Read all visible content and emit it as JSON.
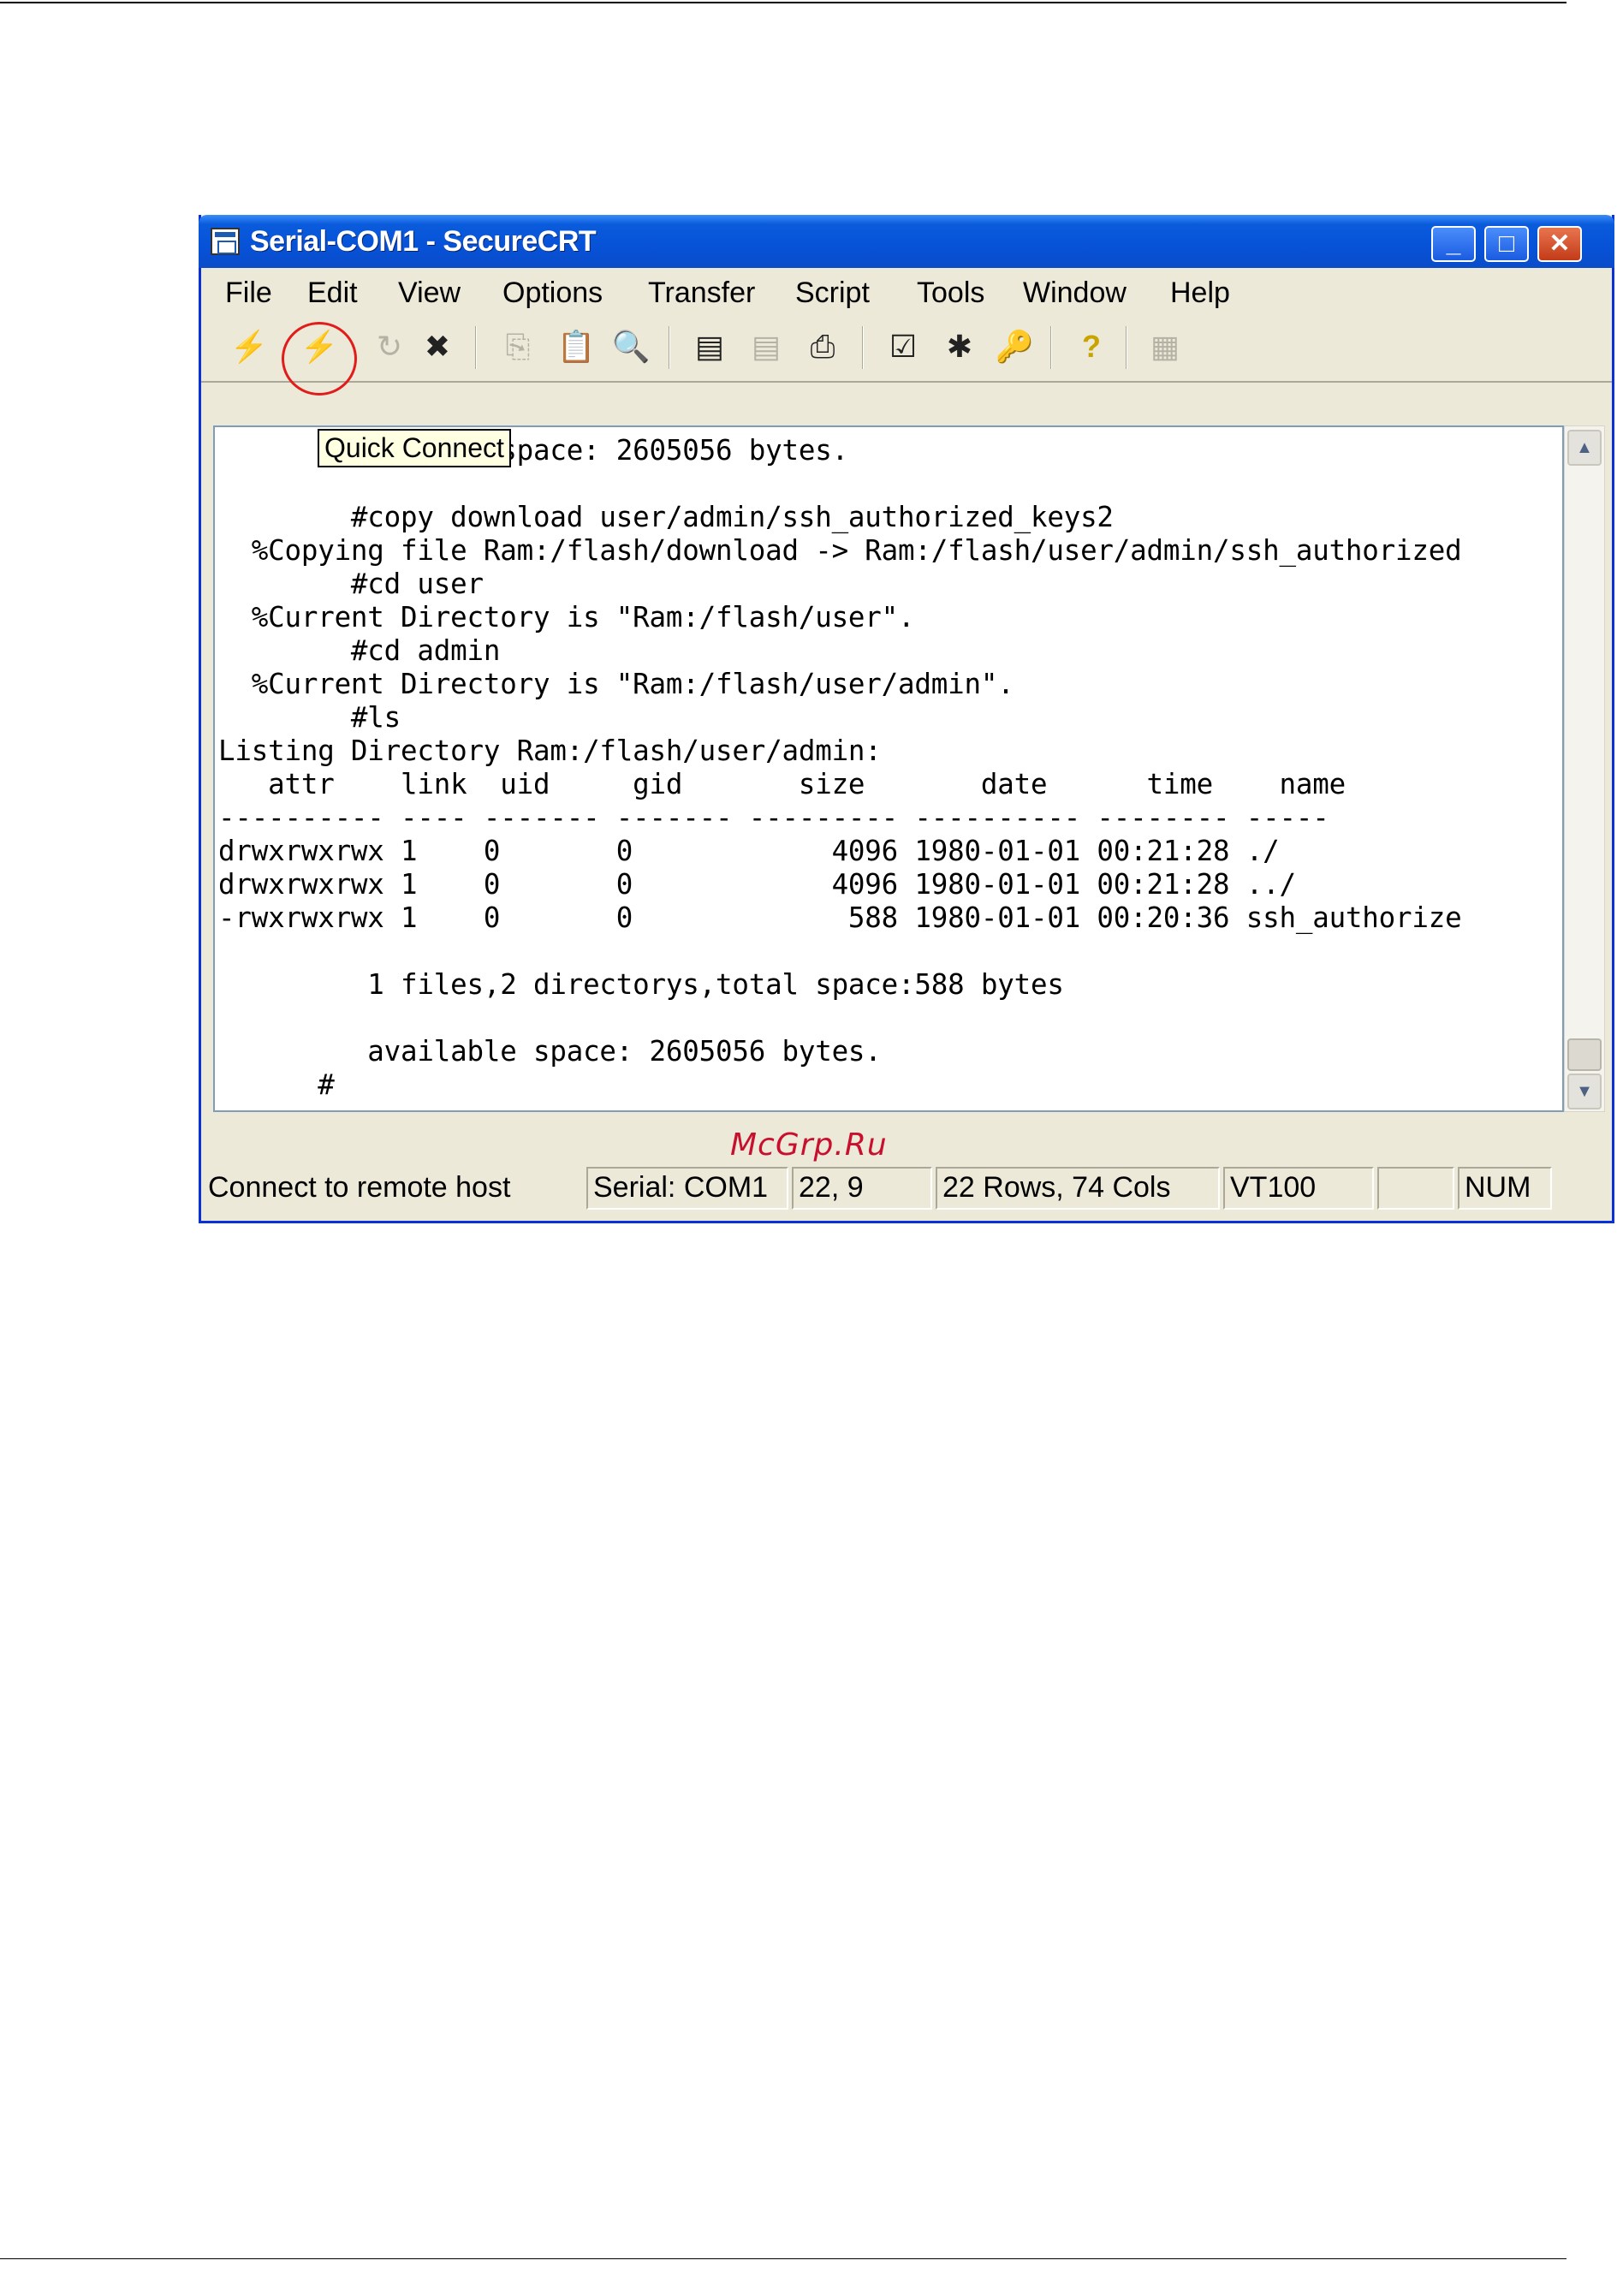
{
  "window": {
    "title": "Serial-COM1 - SecureCRT",
    "minimize_glyph": "_",
    "maximize_glyph": "□",
    "close_glyph": "✕"
  },
  "menu": [
    "File",
    "Edit",
    "View",
    "Options",
    "Transfer",
    "Script",
    "Tools",
    "Window",
    "Help"
  ],
  "toolbar": {
    "buttons": [
      {
        "icon": "connect-icon",
        "glyph": "⚡",
        "enabled": true
      },
      {
        "icon": "quick-connect-icon",
        "glyph": "⚡",
        "enabled": true
      },
      {
        "icon": "reconnect-icon",
        "glyph": "↻",
        "enabled": false
      },
      {
        "icon": "disconnect-icon",
        "glyph": "✖",
        "enabled": true
      },
      {
        "icon": "copy-icon",
        "glyph": "⎘",
        "enabled": false
      },
      {
        "icon": "paste-icon",
        "glyph": "📋",
        "enabled": true
      },
      {
        "icon": "find-icon",
        "glyph": "🔍",
        "enabled": true
      },
      {
        "icon": "print-screen-icon",
        "glyph": "▤",
        "enabled": true
      },
      {
        "icon": "print-selection-icon",
        "glyph": "▤",
        "enabled": false
      },
      {
        "icon": "print-icon",
        "glyph": "⎙",
        "enabled": true
      },
      {
        "icon": "session-options-icon",
        "glyph": "☑",
        "enabled": true
      },
      {
        "icon": "global-options-icon",
        "glyph": "✱",
        "enabled": true
      },
      {
        "icon": "keymap-icon",
        "glyph": "🔑",
        "enabled": false
      },
      {
        "icon": "help-icon",
        "glyph": "?",
        "enabled": true
      },
      {
        "icon": "sftp-icon",
        "glyph": "▦",
        "enabled": false
      }
    ],
    "tooltip": "Quick Connect"
  },
  "terminal": {
    "lines": [
      "       available space: 2605056 bytes.",
      "",
      "        #copy download user/admin/ssh_authorized_keys2",
      "  %Copying file Ram:/flash/download -> Ram:/flash/user/admin/ssh_authorized",
      "        #cd user",
      "  %Current Directory is \"Ram:/flash/user\".",
      "        #cd admin",
      "  %Current Directory is \"Ram:/flash/user/admin\".",
      "        #ls",
      "Listing Directory Ram:/flash/user/admin:",
      "   attr    link  uid     gid       size       date      time    name",
      "---------- ---- ------- ------- --------- ---------- -------- -----",
      "drwxrwxrwx 1    0       0            4096 1980-01-01 00:21:28 ./",
      "drwxrwxrwx 1    0       0            4096 1980-01-01 00:21:28 ../",
      "-rwxrwxrwx 1    0       0             588 1980-01-01 00:20:36 ssh_authorize",
      "",
      "         1 files,2 directorys,total space:588 bytes",
      "",
      "         available space: 2605056 bytes.",
      "      #"
    ]
  },
  "watermark": "McGrp.Ru",
  "statusbar": {
    "message": "Connect to remote host",
    "connection": "Serial: COM1",
    "cursor": "22,  9",
    "size": "22 Rows,  74 Cols",
    "emulation": "VT100",
    "blank": "",
    "num": "NUM"
  }
}
